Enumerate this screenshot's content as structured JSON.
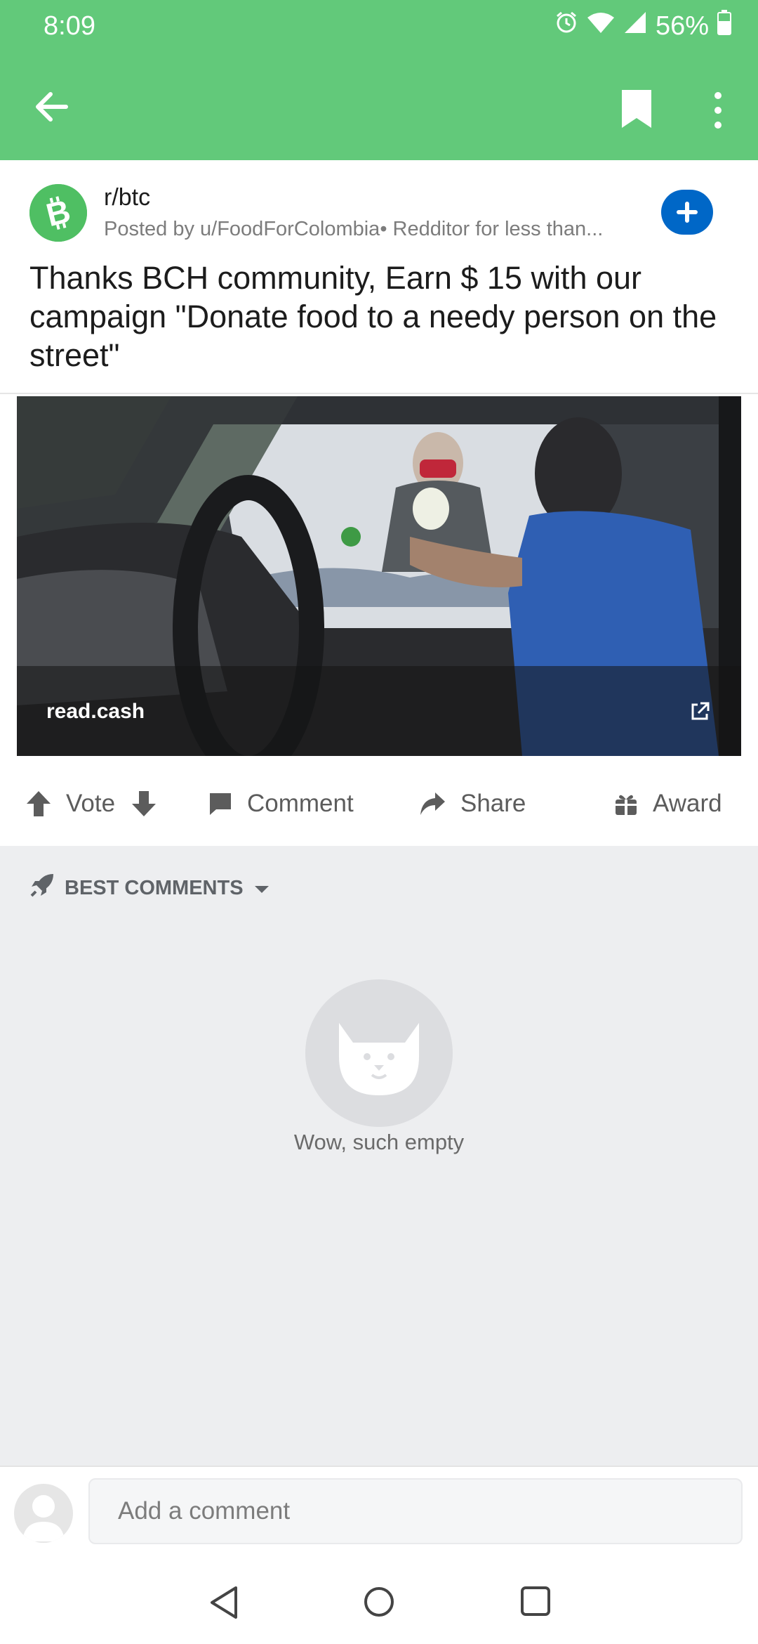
{
  "status_bar": {
    "time": "8:09",
    "battery": "56%",
    "icons": [
      "alarm-icon",
      "wifi-icon",
      "signal-icon",
      "battery-icon"
    ]
  },
  "toolbar": {
    "icons": [
      "back-arrow-icon",
      "bookmark-icon",
      "more-vert-icon"
    ]
  },
  "post": {
    "subreddit": "r/btc",
    "posted_by": "Posted by u/FoodForColombia• Redditor for less than...",
    "title": "Thanks BCH community, Earn $ 15 with our campaign \"Donate food to a needy person on the street\"",
    "join_icon": "plus-icon"
  },
  "link_preview": {
    "domain": "read.cash",
    "icon": "external-link-icon"
  },
  "actions": {
    "vote_label": "Vote",
    "comment_label": "Comment",
    "share_label": "Share",
    "award_label": "Award"
  },
  "comments": {
    "sort_label": "BEST COMMENTS",
    "empty_text": "Wow, such empty"
  },
  "comment_input": {
    "placeholder": "Add a comment"
  },
  "colors": {
    "header_green": "#62c97a",
    "join_blue": "#0067c7",
    "comments_bg": "#edeef0"
  }
}
